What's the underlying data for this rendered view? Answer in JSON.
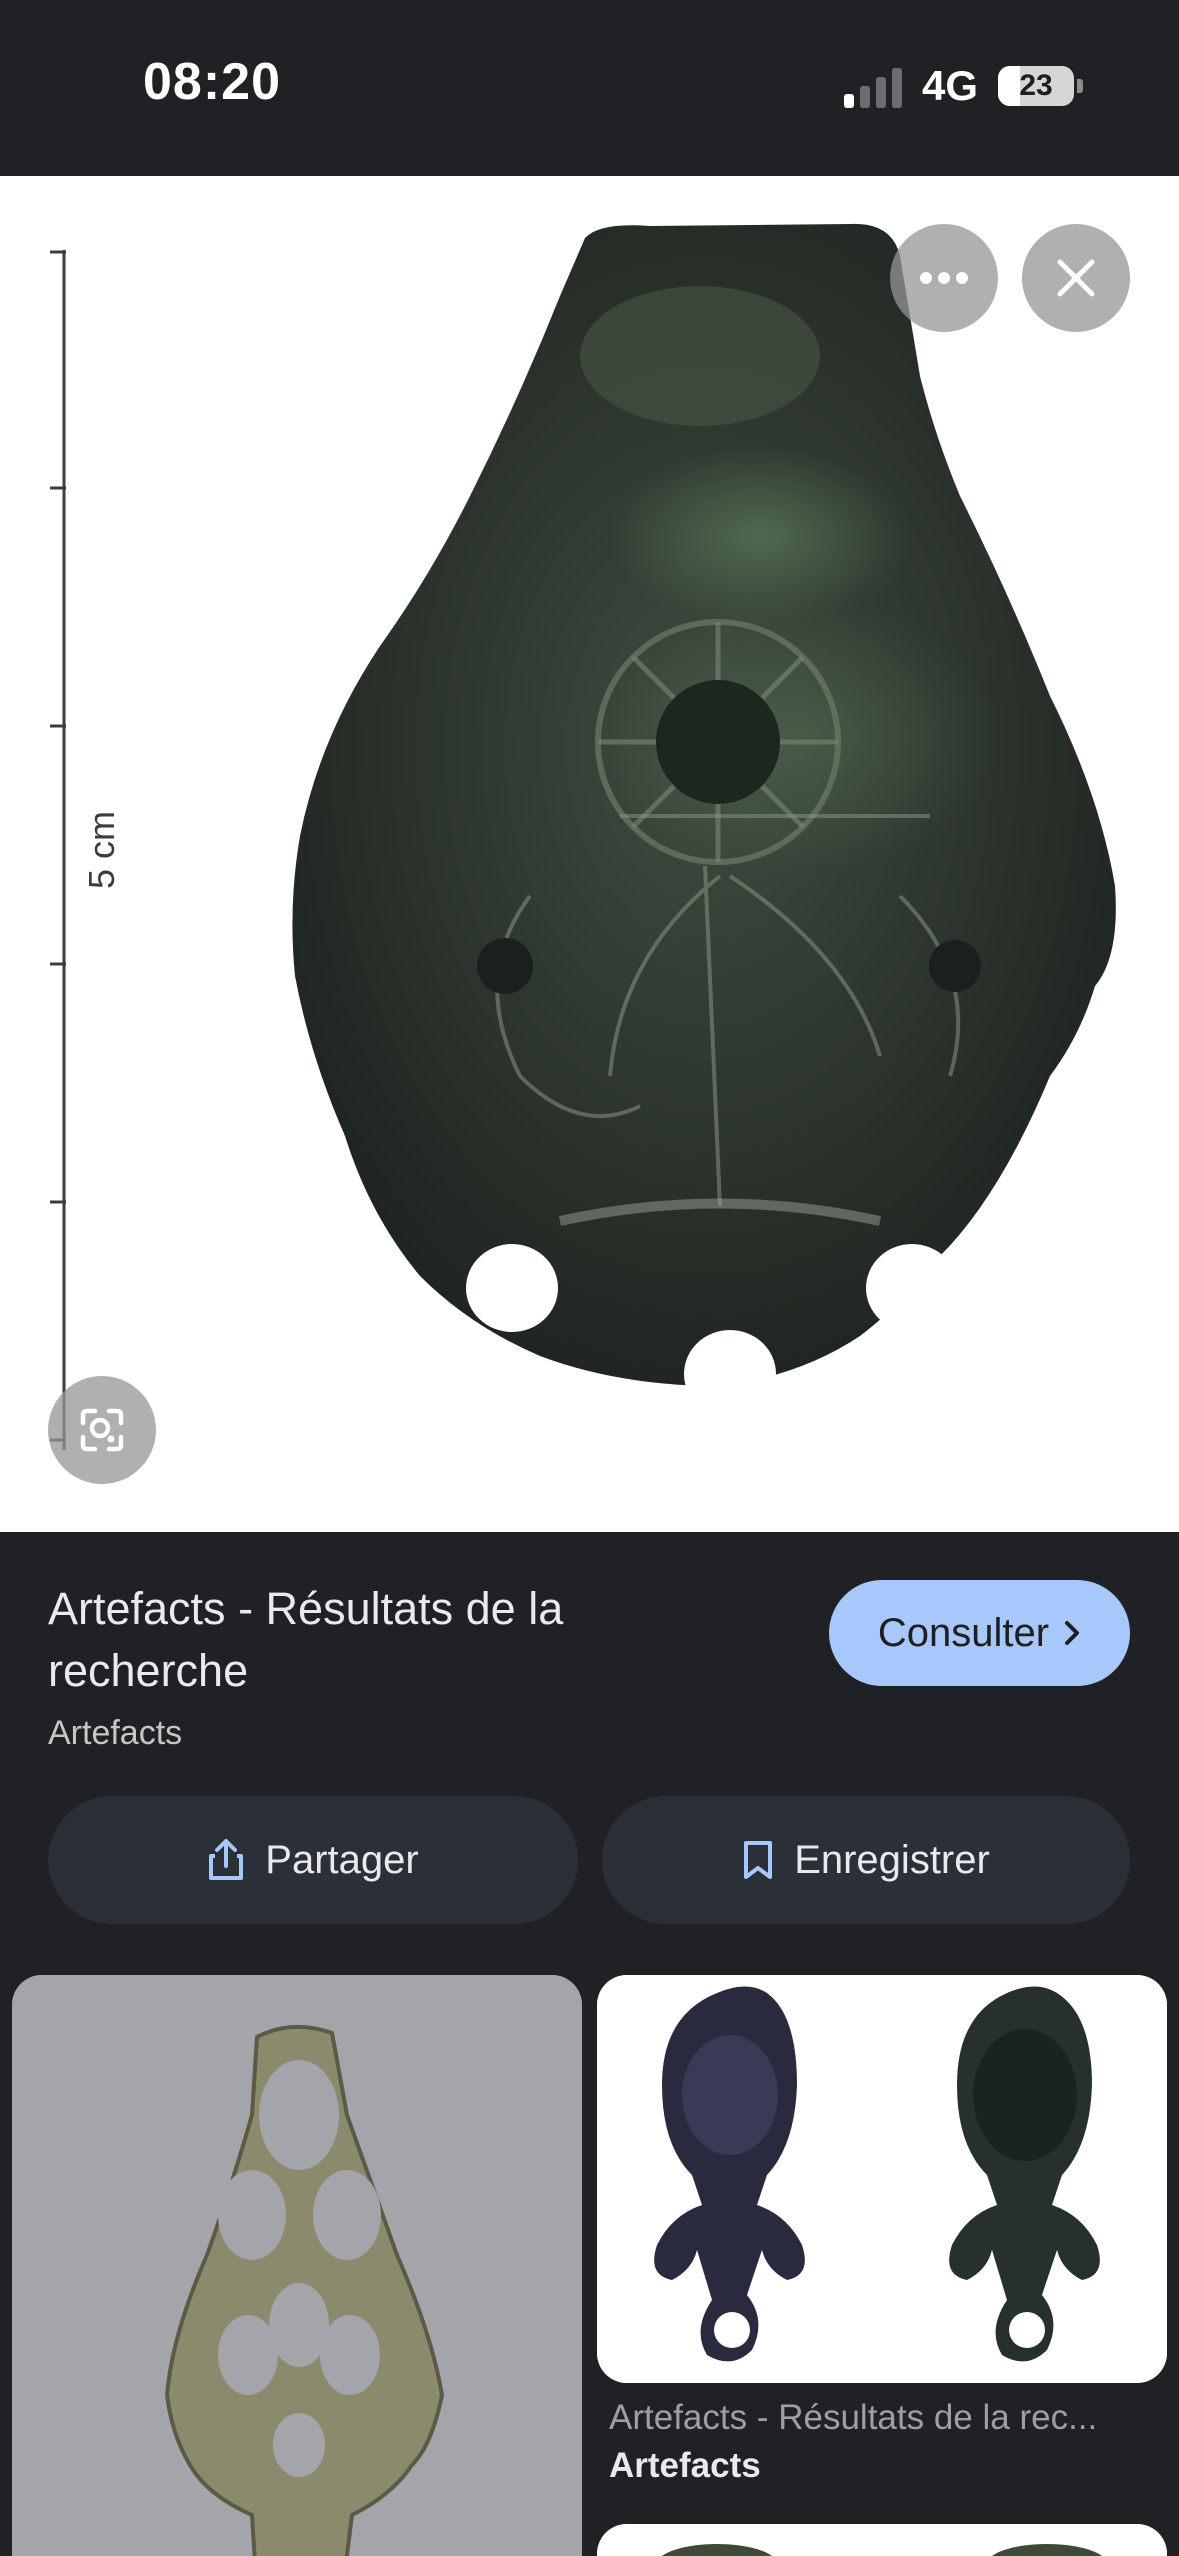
{
  "status_bar": {
    "time": "08:20",
    "network": "4G",
    "battery": "23"
  },
  "image_viewer": {
    "scale_label": "5 cm",
    "more_icon": "more-horizontal-icon",
    "close_icon": "close-icon",
    "lens_icon": "google-lens-icon"
  },
  "result": {
    "title": "Artefacts - Résultats de la recherche",
    "source": "Artefacts",
    "visit_label": "Consulter",
    "share_label": "Partager",
    "save_label": "Enregistrer"
  },
  "related": [
    {
      "title": "",
      "source": ""
    },
    {
      "title": "Artefacts - Résultats de la rec...",
      "source": "Artefacts"
    }
  ],
  "colors": {
    "background": "#202124",
    "accent": "#a8c7fa",
    "button_surface": "#2b2f38"
  }
}
